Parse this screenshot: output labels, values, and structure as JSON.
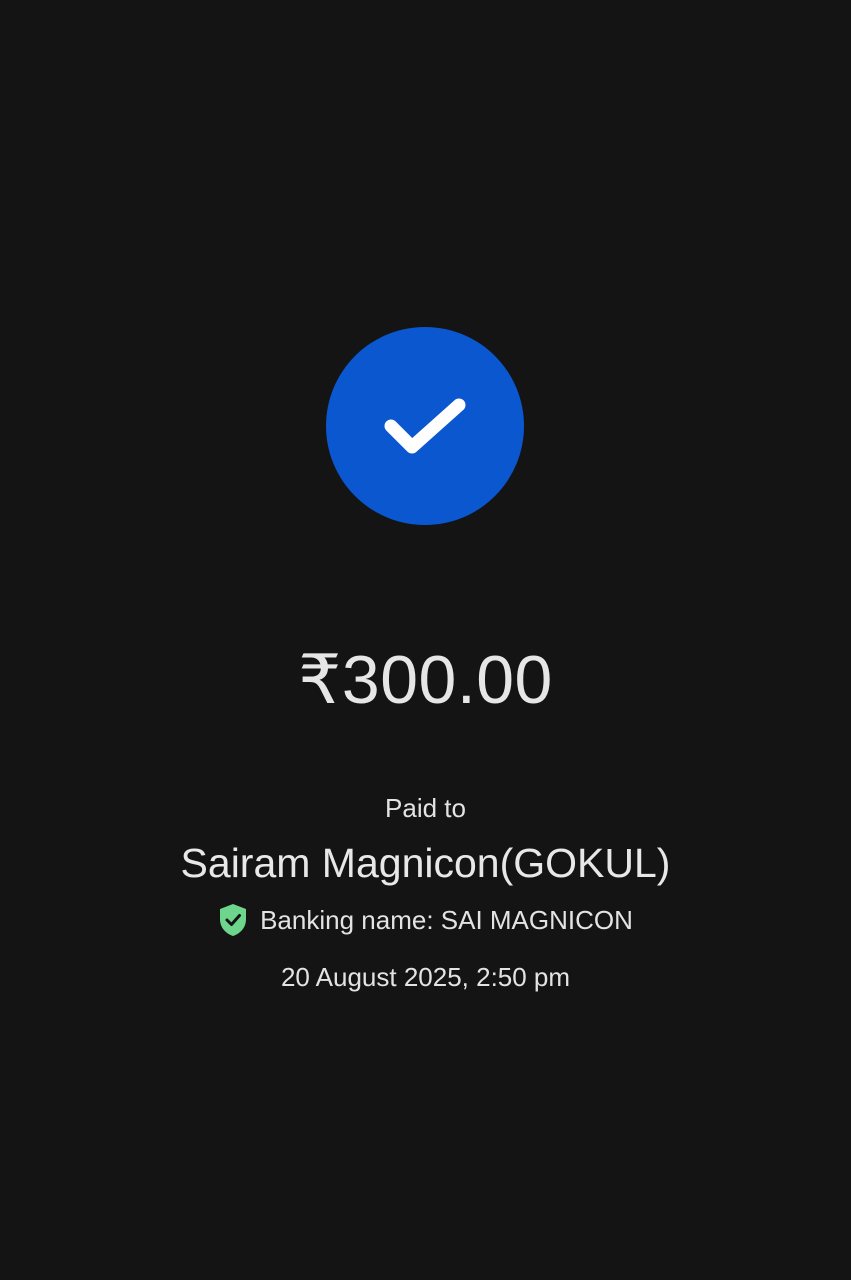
{
  "colors": {
    "background": "#141414",
    "accent": "#0b57d0",
    "check": "#ffffff",
    "verified": "#6dd58c",
    "text": "#e3e3e3"
  },
  "icons": {
    "success": "checkmark-icon",
    "verified": "shield-check-icon"
  },
  "payment": {
    "amount": "₹300.00",
    "paid_to_label": "Paid to",
    "payee_name": "Sairam Magnicon(GOKUL)",
    "banking_name": "Banking name: SAI MAGNICON",
    "datetime": "20 August 2025, 2:50 pm"
  }
}
